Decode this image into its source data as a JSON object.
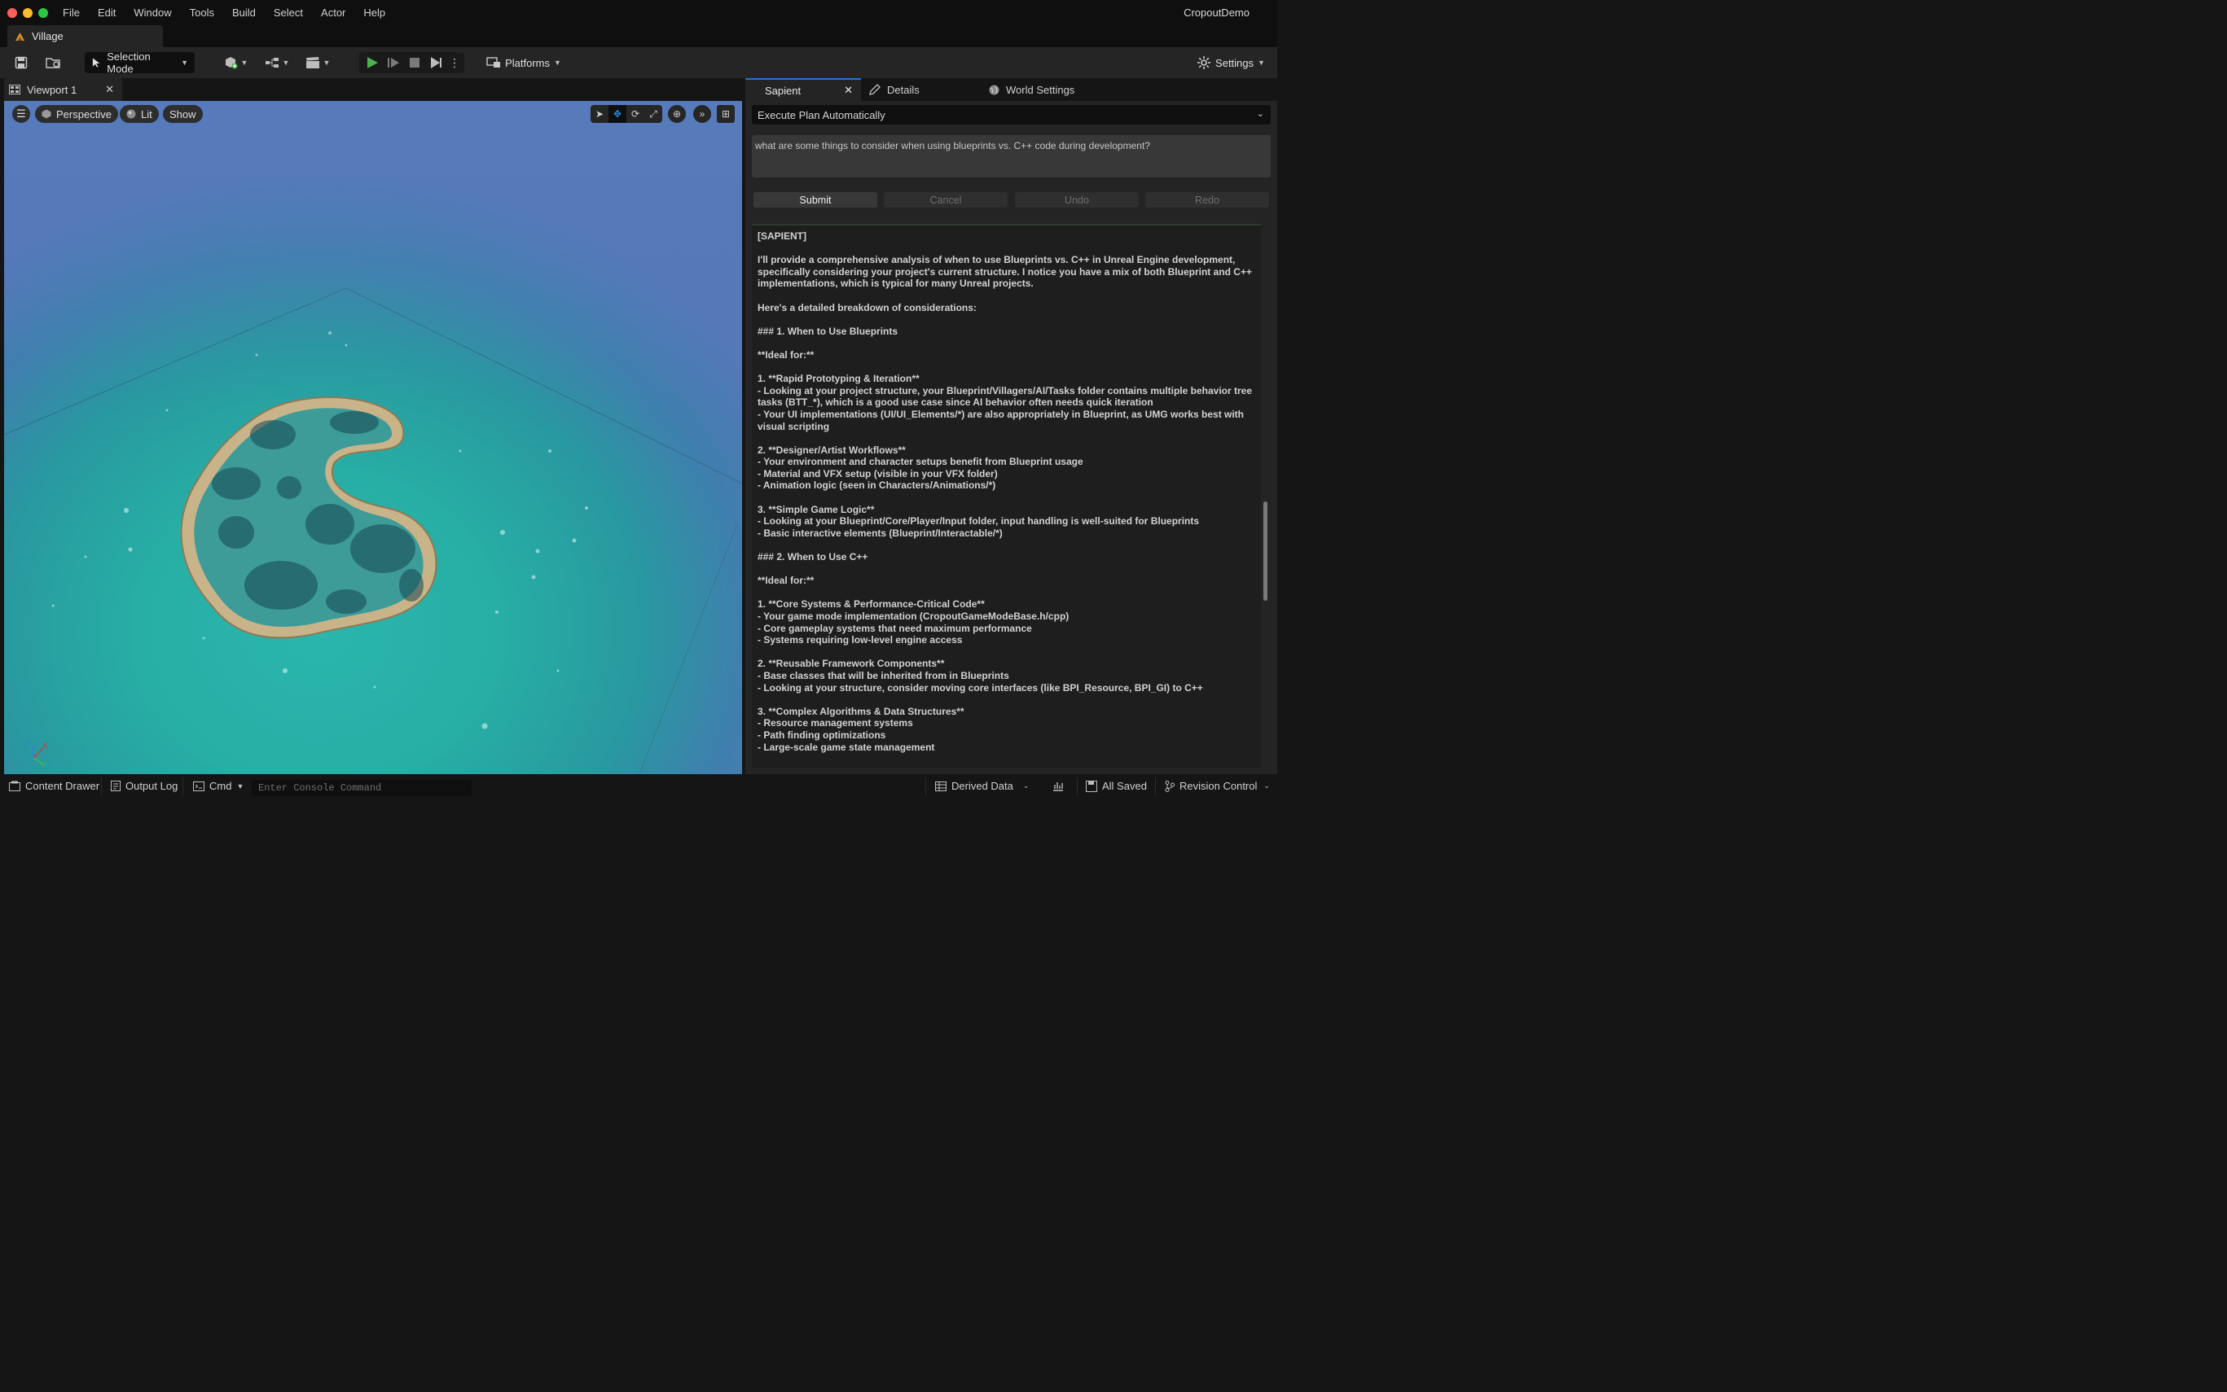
{
  "window": {
    "menu": [
      "File",
      "Edit",
      "Window",
      "Tools",
      "Build",
      "Select",
      "Actor",
      "Help"
    ],
    "project_name": "CropoutDemo",
    "document_tab": "Village"
  },
  "toolbar": {
    "selection_mode": "Selection Mode",
    "platforms": "Platforms",
    "settings": "Settings"
  },
  "viewport": {
    "tab_label": "Viewport 1",
    "perspective": "Perspective",
    "lit": "Lit",
    "show": "Show",
    "axis": {
      "z": "Z",
      "x": "X",
      "y": "Y"
    }
  },
  "right_panel": {
    "tabs": [
      "Sapient",
      "Details",
      "World Settings"
    ],
    "plan_mode": "Execute Plan Automatically",
    "prompt": "what are some things to consider when using blueprints vs. C++ code during development?",
    "buttons": {
      "submit": "Submit",
      "cancel": "Cancel",
      "undo": "Undo",
      "redo": "Redo"
    },
    "output": [
      "[SAPIENT]",
      "I'll provide a comprehensive analysis of when to use Blueprints vs. C++ in Unreal Engine development, specifically considering your project's current structure. I notice you have a mix of both Blueprint and C++ implementations, which is typical for many Unreal projects.",
      "Here's a detailed breakdown of considerations:",
      "### 1. When to Use Blueprints",
      "**Ideal for:**",
      "1. **Rapid Prototyping & Iteration**\n- Looking at your project structure, your Blueprint/Villagers/AI/Tasks folder contains multiple behavior tree tasks (BTT_*), which is a good use case since AI behavior often needs quick iteration\n- Your UI implementations (UI/UI_Elements/*) are also appropriately in Blueprint, as UMG works best with visual scripting",
      "2. **Designer/Artist Workflows**\n- Your environment and character setups benefit from Blueprint usage\n- Material and VFX setup (visible in your VFX folder)\n- Animation logic (seen in Characters/Animations/*)",
      "3. **Simple Game Logic**\n- Looking at your Blueprint/Core/Player/Input folder, input handling is well-suited for Blueprints\n- Basic interactive elements (Blueprint/Interactable/*)",
      "### 2. When to Use C++",
      "**Ideal for:**",
      "1. **Core Systems & Performance-Critical Code**\n- Your game mode implementation (CropoutGameModeBase.h/cpp)\n- Core gameplay systems that need maximum performance\n- Systems requiring low-level engine access",
      "2. **Reusable Framework Components**\n- Base classes that will be inherited from in Blueprints\n- Looking at your structure, consider moving core interfaces (like BPI_Resource, BPI_GI) to C++",
      "3. **Complex Algorithms & Data Structures**\n- Resource management systems\n- Path finding optimizations\n- Large-scale game state management"
    ],
    "scroll_fraction": 0.62
  },
  "statusbar": {
    "content_drawer": "Content Drawer",
    "output_log": "Output Log",
    "cmd": "Cmd",
    "console_placeholder": "Enter Console Command",
    "derived_data": "Derived Data",
    "all_saved": "All Saved",
    "revision_control": "Revision Control"
  },
  "colors": {
    "accent_blue": "#2673d6",
    "play_green": "#4caf50",
    "water": "#27aea5",
    "sky": "#5477b8"
  }
}
